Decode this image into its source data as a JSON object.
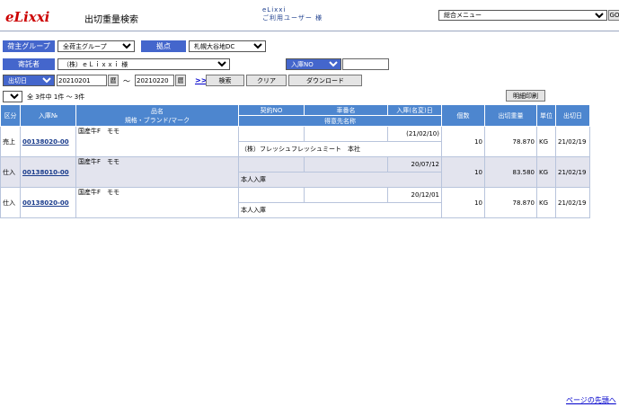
{
  "header": {
    "logo": "eLixxi",
    "page_title": "出切重量検索",
    "user_line1": "eLixxi",
    "user_line2": "ご利用ユーザー 様",
    "menu_selected": "総合メニュー",
    "go_label": "GO"
  },
  "filters": {
    "shipper_group_label": "荷主グループ",
    "shipper_group_value": "全荷主グループ",
    "base_label": "拠点",
    "base_value": "札幌大谷地DC",
    "consignor_label": "寄託者",
    "consignor_value": "（株）ｅＬｉｘｘｉ 様",
    "receipt_no_select": "入庫NO",
    "receipt_no_value": "",
    "date_type_select": "出切日",
    "date_from": "20210201",
    "date_to": "20210220",
    "calendar_label": "暦",
    "tilde": "～",
    "next_label": ">>",
    "search_btn": "検索",
    "clear_btn": "クリア",
    "download_btn": "ダウンロード"
  },
  "paging": {
    "page_select": "1",
    "summary": "全 3件中 1件 ～ 3件",
    "print_btn": "明細印刷"
  },
  "table": {
    "headers": {
      "kubun": "区分",
      "receipt_no": "入庫№",
      "item_name": "品名",
      "item_spec": "規格・ブランド/マーク",
      "contract_no": "契約NO",
      "vehicle": "車番名",
      "receipt_date": "入庫(名変)日",
      "customer": "得意先名称",
      "qty": "個数",
      "weight": "出切重量",
      "unit": "単位",
      "out_date": "出切日"
    },
    "rows": [
      {
        "kubun": "売上",
        "code": "00138020-00",
        "item": "国産牛F　モモ",
        "contract": "",
        "vehicle": "",
        "date": "(21/02/10)",
        "customer": "（株）フレッシュフレッシュミート　本社",
        "qty": "10",
        "weight": "78.870",
        "unit": "KG",
        "out_date": "21/02/19"
      },
      {
        "kubun": "仕入",
        "code": "00138010-00",
        "item": "国産牛F　モモ",
        "contract": "",
        "vehicle": "",
        "date": "20/07/12",
        "customer": "本人入庫",
        "qty": "10",
        "weight": "83.580",
        "unit": "KG",
        "out_date": "21/02/19"
      },
      {
        "kubun": "仕入",
        "code": "00138020-00",
        "item": "国産牛F　モモ",
        "contract": "",
        "vehicle": "",
        "date": "20/12/01",
        "customer": "本人入庫",
        "qty": "10",
        "weight": "78.870",
        "unit": "KG",
        "out_date": "21/02/19"
      }
    ]
  },
  "footer": {
    "page_top": "ページの先頭へ"
  }
}
